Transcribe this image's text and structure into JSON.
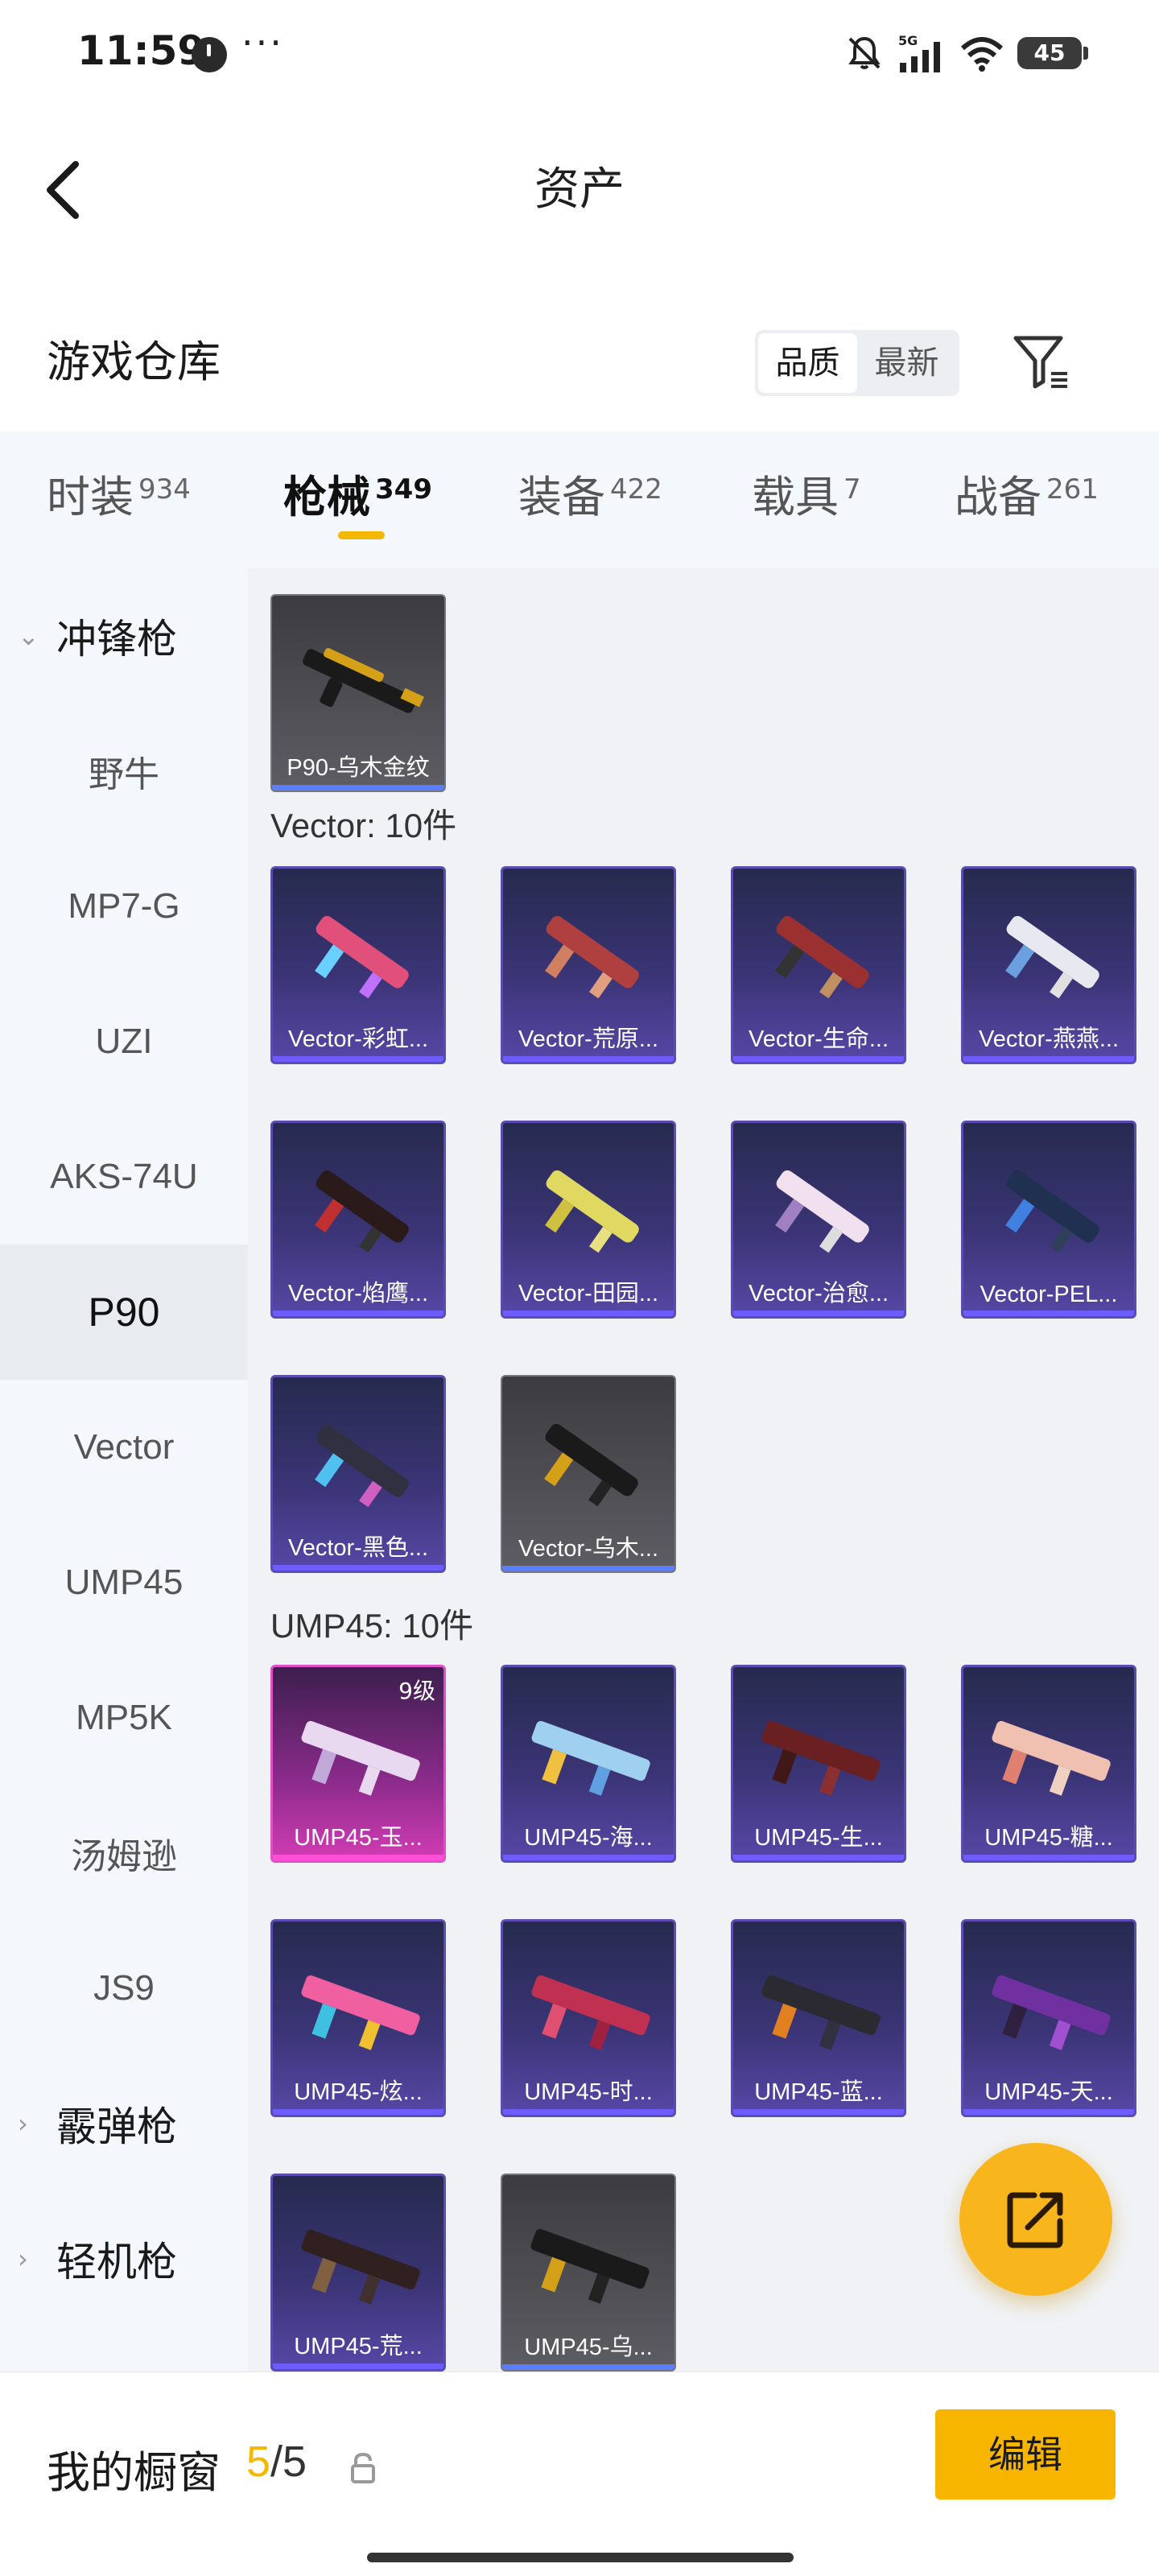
{
  "status_bar": {
    "time": "11:59",
    "dots": "···",
    "battery": "45"
  },
  "header": {
    "title": "资产"
  },
  "warehouse": {
    "title": "游戏仓库",
    "sort_options": [
      "品质",
      "最新"
    ],
    "active_sort": "品质"
  },
  "tabs": [
    {
      "label": "时装",
      "count": "934"
    },
    {
      "label": "枪械",
      "count": "349",
      "active": true
    },
    {
      "label": "装备",
      "count": "422"
    },
    {
      "label": "载具",
      "count": "7"
    },
    {
      "label": "战备",
      "count": "261"
    }
  ],
  "sidebar": {
    "group_open": "冲锋枪",
    "items": [
      "野牛",
      "MP7-G",
      "UZI",
      "AKS-74U",
      "P90",
      "Vector",
      "UMP45",
      "MP5K",
      "汤姆逊",
      "JS9"
    ],
    "active_item": "P90",
    "group_shotgun": "霰弹枪",
    "group_lmg": "轻机枪"
  },
  "content": {
    "p90_items": [
      {
        "label": "P90-乌木金纹",
        "style": "gray"
      }
    ],
    "vector_label": "Vector: 10件",
    "vector_items": [
      {
        "label": "Vector-彩虹...",
        "style": "purple"
      },
      {
        "label": "Vector-荒原...",
        "style": "purple"
      },
      {
        "label": "Vector-生命...",
        "style": "purple"
      },
      {
        "label": "Vector-燕燕...",
        "style": "purple"
      },
      {
        "label": "Vector-焰鹰...",
        "style": "purple"
      },
      {
        "label": "Vector-田园...",
        "style": "purple"
      },
      {
        "label": "Vector-治愈...",
        "style": "purple"
      },
      {
        "label": "Vector-PEL...",
        "style": "purple"
      },
      {
        "label": "Vector-黑色...",
        "style": "purple"
      },
      {
        "label": "Vector-乌木...",
        "style": "gray"
      }
    ],
    "ump_label": "UMP45: 10件",
    "ump_items": [
      {
        "label": "UMP45-玉...",
        "style": "pink",
        "level": "9级"
      },
      {
        "label": "UMP45-海...",
        "style": "purple"
      },
      {
        "label": "UMP45-生...",
        "style": "purple"
      },
      {
        "label": "UMP45-糖...",
        "style": "purple"
      },
      {
        "label": "UMP45-炫...",
        "style": "purple"
      },
      {
        "label": "UMP45-时...",
        "style": "purple"
      },
      {
        "label": "UMP45-蓝...",
        "style": "purple"
      },
      {
        "label": "UMP45-天...",
        "style": "purple"
      },
      {
        "label": "UMP45-荒...",
        "style": "purple"
      },
      {
        "label": "UMP45-乌...",
        "style": "gray"
      }
    ]
  },
  "bottom": {
    "showcase_label": "我的橱窗",
    "showcase_current": "5",
    "showcase_total": "/5",
    "edit_label": "编辑"
  },
  "colors": {
    "accent": "#f8b500",
    "rarity_purple": "#5a4cb0",
    "rarity_pink": "#e04fc8",
    "rarity_gray": "#767680"
  }
}
